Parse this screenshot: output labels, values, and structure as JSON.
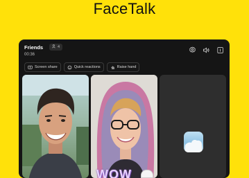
{
  "hero": {
    "title": "FaceTalk"
  },
  "call": {
    "title": "Friends",
    "participants_count": "4",
    "duration": "00:36"
  },
  "controls": {
    "screen_share": "Screen share",
    "quick_reactions": "Quick reactions",
    "raise_hand": "Raise hand"
  },
  "header_icons": [
    "settings-icon",
    "speaker-icon",
    "exit-icon"
  ],
  "stickers": {
    "reaction_text": "WOW"
  },
  "colors": {
    "background": "#FFE10A",
    "window": "#151515",
    "tile_empty": "#2E2E2E"
  }
}
